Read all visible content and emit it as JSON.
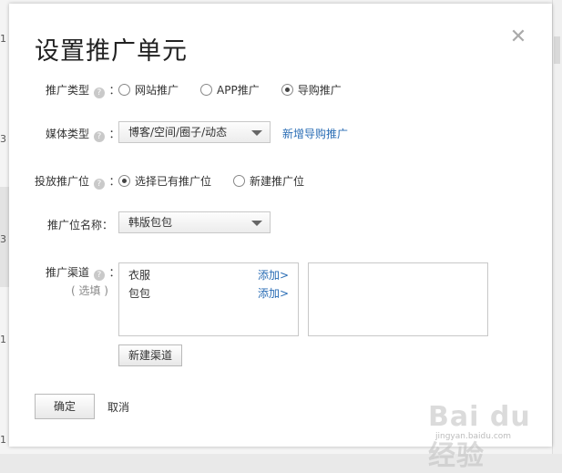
{
  "background": {
    "edge_numbers": [
      "1",
      "3",
      "3",
      "1",
      "1"
    ]
  },
  "dialog": {
    "title": "设置推广单元",
    "close_glyph": "✕",
    "help_glyph": "?",
    "promo_type": {
      "label_pre": "推广类型",
      "label_post": "：",
      "options": [
        {
          "label": "网站推广",
          "selected": false
        },
        {
          "label": "APP推广",
          "selected": false
        },
        {
          "label": "导购推广",
          "selected": true
        }
      ]
    },
    "media_type": {
      "label_pre": "媒体类型",
      "label_post": "：",
      "value": "博客/空间/圈子/动态",
      "link": "新增导购推广"
    },
    "placement": {
      "label_pre": "投放推广位",
      "label_post": "：",
      "options": [
        {
          "label": "选择已有推广位",
          "selected": true
        },
        {
          "label": "新建推广位",
          "selected": false
        }
      ]
    },
    "placement_name": {
      "label": "推广位名称：",
      "value": "韩版包包"
    },
    "channel": {
      "label_pre": "推广渠道",
      "label_post": "：",
      "optional": "( 选填 )",
      "items": [
        {
          "name": "衣服",
          "action": "添加>"
        },
        {
          "name": "包包",
          "action": "添加>"
        }
      ],
      "new_button": "新建渠道"
    },
    "confirm_button": "确定",
    "cancel_button": "取消"
  },
  "watermark": {
    "brand": "Bai du 经验",
    "sub": "jingyan.baidu.com"
  },
  "colors": {
    "link": "#2a6db5",
    "title": "#222222",
    "dialog_bg": "#ffffff"
  }
}
